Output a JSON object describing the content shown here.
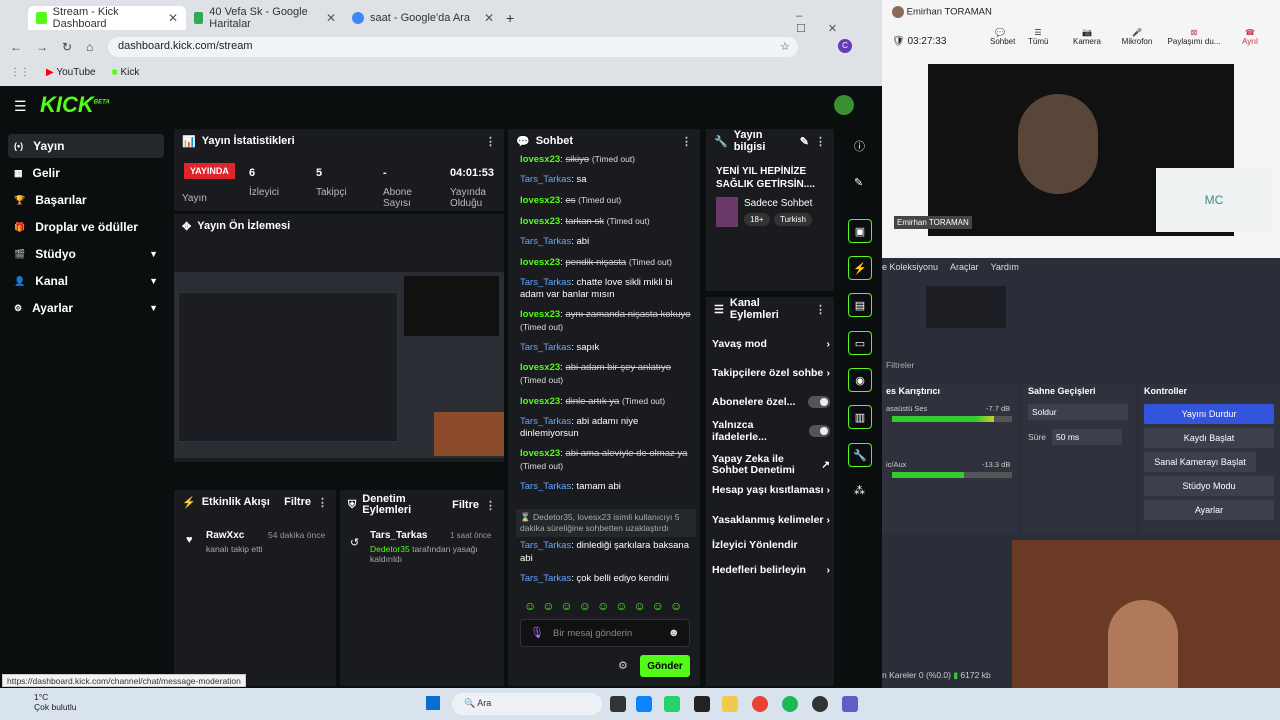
{
  "tabs": [
    {
      "label": "Stream - Kick Dashboard",
      "color": "#53fc18"
    },
    {
      "label": "40 Vefa Sk - Google Haritalar",
      "color": "#34a853"
    },
    {
      "label": "saat - Google'da Ara",
      "color": "#4285f4"
    }
  ],
  "url": "dashboard.kick.com/stream",
  "bookmarks": [
    "YouTube",
    "Kick"
  ],
  "kick": {
    "logo": "KICK",
    "beta": "BETA",
    "nav": [
      {
        "label": "Yayın",
        "icon": "(•)"
      },
      {
        "label": "Gelir",
        "icon": "▦"
      },
      {
        "label": "Başarılar",
        "icon": "🏆"
      },
      {
        "label": "Droplar ve ödüller",
        "icon": "🎁"
      },
      {
        "label": "Stüdyo",
        "icon": "🎬"
      },
      {
        "label": "Kanal",
        "icon": "👤"
      },
      {
        "label": "Ayarlar",
        "icon": "⚙"
      }
    ],
    "stats_title": "Yayın İstatistikleri",
    "live": "YAYINDA",
    "stats": [
      {
        "value": "6",
        "label": "İzleyici"
      },
      {
        "value": "5",
        "label": "Takipçi"
      },
      {
        "value": "-",
        "label": "Abone Sayısı"
      },
      {
        "value": "04:01:53",
        "label": "Yayında Olduğu"
      }
    ],
    "live_label": "Yayın",
    "preview_title": "Yayın Ön İzlemesi",
    "activity_title": "Etkinlik Akışı",
    "filter": "Filtre",
    "activity": {
      "user": "RawXxc",
      "time": "54 dakika önce",
      "text": "kanalı takip etti"
    },
    "moderation_title": "Denetim Eylemleri",
    "moderation": {
      "user": "Tars_Tarkas",
      "time": "1 saat önce",
      "mod": "Dedetor35",
      "text": "tarafından yasağı kaldırıldı"
    },
    "chat_title": "Sohbet",
    "chat": [
      {
        "user": "lovesx23",
        "cls": "u1",
        "msg": "sikiyo",
        "to": "(Timed out)",
        "strike": true
      },
      {
        "user": "Tars_Tarkas",
        "cls": "u2",
        "msg": "sa"
      },
      {
        "user": "lovesx23",
        "cls": "u1",
        "msg": "es",
        "to": "(Timed out)",
        "strike": true
      },
      {
        "user": "lovesx23",
        "cls": "u1",
        "msg": "tarkan sk",
        "to": "(Timed out)",
        "strike": true
      },
      {
        "user": "Tars_Tarkas",
        "cls": "u2",
        "msg": "abi"
      },
      {
        "user": "lovesx23",
        "cls": "u1",
        "msg": "pendik nişasta",
        "to": "(Timed out)",
        "strike": true
      },
      {
        "user": "Tars_Tarkas",
        "cls": "u2",
        "msg": "chatte love sikli mikli bi adam var banlar mısın"
      },
      {
        "user": "lovesx23",
        "cls": "u1",
        "msg": "aynı zamanda nişasta kokuyo",
        "to": "(Timed out)",
        "strike": true
      },
      {
        "user": "Tars_Tarkas",
        "cls": "u2",
        "msg": "sapık"
      },
      {
        "user": "lovesx23",
        "cls": "u1",
        "msg": "abi adam bir şey anlatıyo",
        "to": "(Timed out)",
        "strike": true
      },
      {
        "user": "lovesx23",
        "cls": "u1",
        "msg": "dinle artık ya",
        "to": "(Timed out)",
        "strike": true
      },
      {
        "user": "Tars_Tarkas",
        "cls": "u2",
        "msg": "abi adamı niye dinlemiyorsun"
      },
      {
        "user": "lovesx23",
        "cls": "u1",
        "msg": "abi ama aleviyle de olmaz ya",
        "to": "(Timed out)",
        "strike": true
      },
      {
        "user": "Tars_Tarkas",
        "cls": "u2",
        "msg": "tamam abi"
      }
    ],
    "system_msg": "Dedetor35, lovesx23 isimli kullanıcıyı 5 dakika süreliğine sohbetten uzaklaştırdı",
    "chat2": [
      {
        "user": "Tars_Tarkas",
        "msg": "dinlediği şarkılara baksana abi"
      },
      {
        "user": "Tars_Tarkas",
        "msg": "çok belli ediyo kendini"
      }
    ],
    "chat_placeholder": "Bir mesaj gönderin",
    "send": "Gönder",
    "info_title": "Yayın bilgisi",
    "stream_title": "YENİ YIL HEPİNİZE SAĞLIK GETİRSİN....",
    "category": "Sadece Sohbet",
    "tags": [
      "18+",
      "Turkish"
    ],
    "actions_title": "Kanal Eylemleri",
    "actions": [
      {
        "label": "Yavaş mod",
        "kind": "arrow"
      },
      {
        "label": "Takipçilere özel sohbe",
        "kind": "arrow"
      },
      {
        "label": "Abonelere özel...",
        "kind": "toggle"
      },
      {
        "label": "Yalnızca ifadelerle...",
        "kind": "toggle"
      },
      {
        "label": "Yapay Zeka ile Sohbet Denetimi",
        "kind": "ext"
      },
      {
        "label": "Hesap yaşı kısıtlaması",
        "kind": "arrow"
      },
      {
        "label": "Yasaklanmış kelimeler",
        "kind": "arrow"
      },
      {
        "label": "İzleyici Yönlendir",
        "kind": "none"
      },
      {
        "label": "Hedefleri belirleyin",
        "kind": "arrow"
      }
    ]
  },
  "status_url": "https://dashboard.kick.com/channel/chat/message-moderation",
  "teams": {
    "name": "Emirhan TORAMAN",
    "time": "03:27:33",
    "buttons": [
      "Sohbet",
      "Tümü",
      "Kamera",
      "Mikrofon",
      "Paylaşımı du...",
      "Ayrıl"
    ],
    "label": "Emirhan TORAMAN",
    "initials": "MC"
  },
  "obs": {
    "menu": [
      "e Koleksiyonu",
      "Araçlar",
      "Yardım"
    ],
    "filters": "Filtreler",
    "mixer": "es Karıştırıcı",
    "mixer_tracks": [
      {
        "name": "asaüstü Ses",
        "db": "-7.7 dB"
      },
      {
        "name": "ic/Aux",
        "db": "-13.3 dB"
      }
    ],
    "transitions": "Sahne Geçişleri",
    "fade": "Soldur",
    "duration_label": "Süre",
    "duration": "50 ms",
    "controls": "Kontroller",
    "buttons": [
      "Yayını Durdur",
      "Kaydı Başlat",
      "Sanal Kamerayı Başlat",
      "Stüdyo Modu",
      "Ayarlar"
    ],
    "status": "n Kareler 0 (%0.0)",
    "kbps": "6172 kb"
  },
  "taskbar": {
    "temp": "1°C",
    "weather": "Çok bulutlu",
    "search": "Ara"
  }
}
